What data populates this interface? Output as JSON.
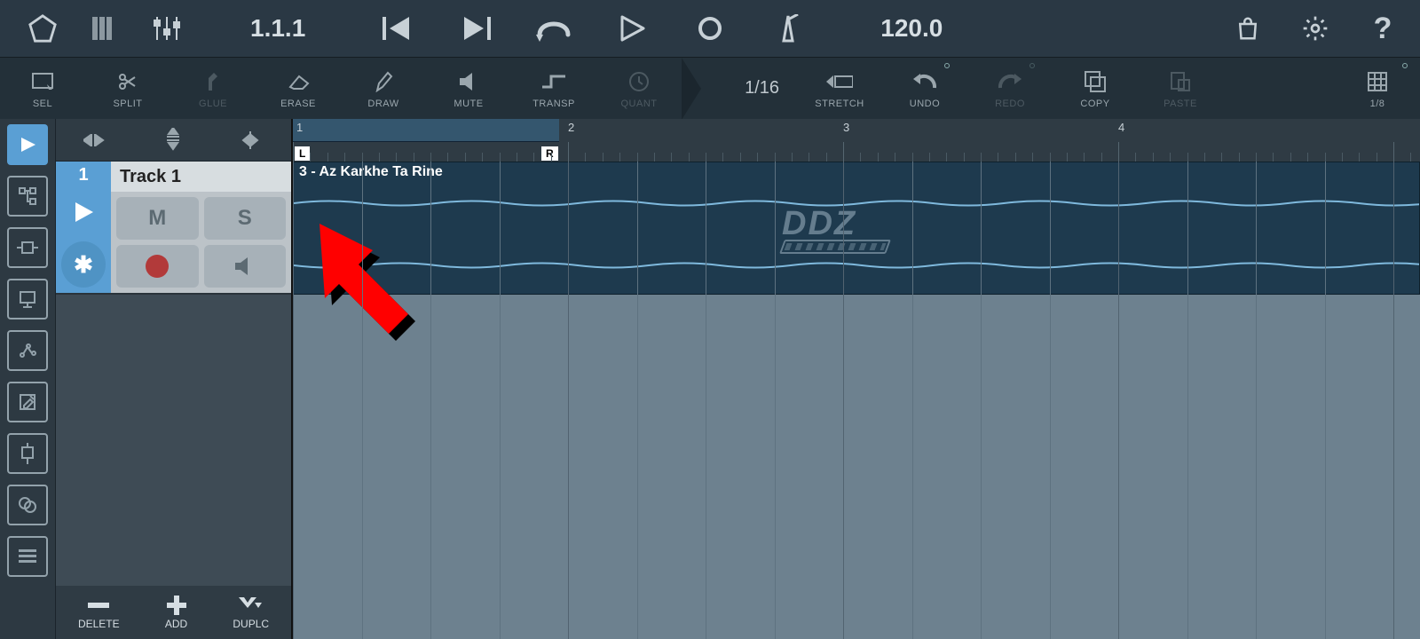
{
  "topbar": {
    "position": "1.1.1",
    "tempo": "120.0"
  },
  "tools": {
    "sel": "SEL",
    "split": "SPLIT",
    "glue": "GLUE",
    "erase": "ERASE",
    "draw": "DRAW",
    "mute": "MUTE",
    "transp": "TRANSP",
    "quant": "QUANT",
    "snap": "1/16",
    "stretch": "STRETCH",
    "undo": "UNDO",
    "redo": "REDO",
    "copy": "COPY",
    "paste": "PASTE",
    "grid": "1/8"
  },
  "track": {
    "number": "1",
    "name": "Track 1",
    "mute": "M",
    "solo": "S"
  },
  "ruler": {
    "bars": [
      "1",
      "2",
      "3",
      "4"
    ],
    "locator_left": "L",
    "locator_right": "R"
  },
  "clip": {
    "name": "3 - Az Karkhe Ta Rine"
  },
  "footer": {
    "delete": "DELETE",
    "add": "ADD",
    "duplc": "DUPLC"
  },
  "watermark": "DDZ"
}
